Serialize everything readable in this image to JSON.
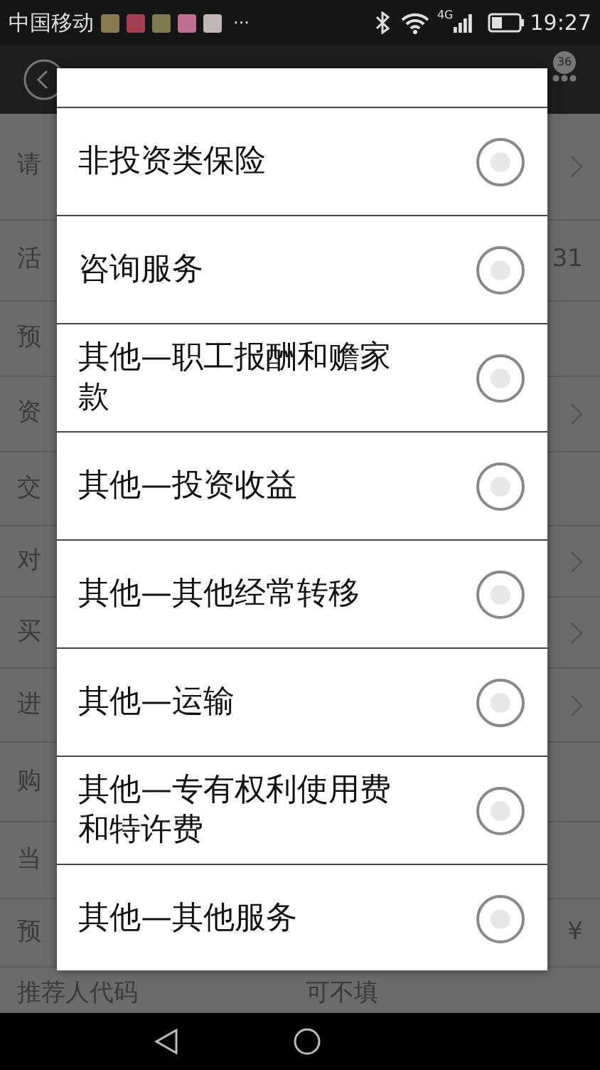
{
  "status_bar": {
    "carrier": "中国移动",
    "more": "···",
    "network": "4G",
    "time": "19:27"
  },
  "header": {
    "badge": "36"
  },
  "form_rows": [
    {
      "label": "请",
      "value": "",
      "has_arrow": true
    },
    {
      "label": "活",
      "value": "31",
      "has_arrow": false
    },
    {
      "label": "预",
      "value": "",
      "has_arrow": false
    },
    {
      "label": "资",
      "value": "",
      "has_arrow": true
    },
    {
      "label": "交",
      "value": "",
      "has_arrow": false
    },
    {
      "label": "对",
      "value": "",
      "has_arrow": true
    },
    {
      "label": "买",
      "value": "",
      "has_arrow": true
    },
    {
      "label": "进",
      "value": "",
      "has_arrow": true
    },
    {
      "label": "购",
      "value": "",
      "has_arrow": false
    },
    {
      "label": "当",
      "value": "",
      "has_arrow": false
    },
    {
      "label": "预",
      "value": "¥",
      "has_arrow": false
    },
    {
      "label": "推荐人代码",
      "value": "可不填",
      "has_arrow": false
    }
  ],
  "dialog": {
    "options": [
      {
        "label": "非投资类保险",
        "selected": false
      },
      {
        "label": "咨询服务",
        "selected": false
      },
      {
        "label": "其他—职工报酬和赡家款",
        "selected": false
      },
      {
        "label": "其他—投资收益",
        "selected": false
      },
      {
        "label": "其他—其他经常转移",
        "selected": false
      },
      {
        "label": "其他—运输",
        "selected": false
      },
      {
        "label": "其他—专有权利使用费和特许费",
        "selected": false
      },
      {
        "label": "其他—其他服务",
        "selected": false
      }
    ]
  }
}
